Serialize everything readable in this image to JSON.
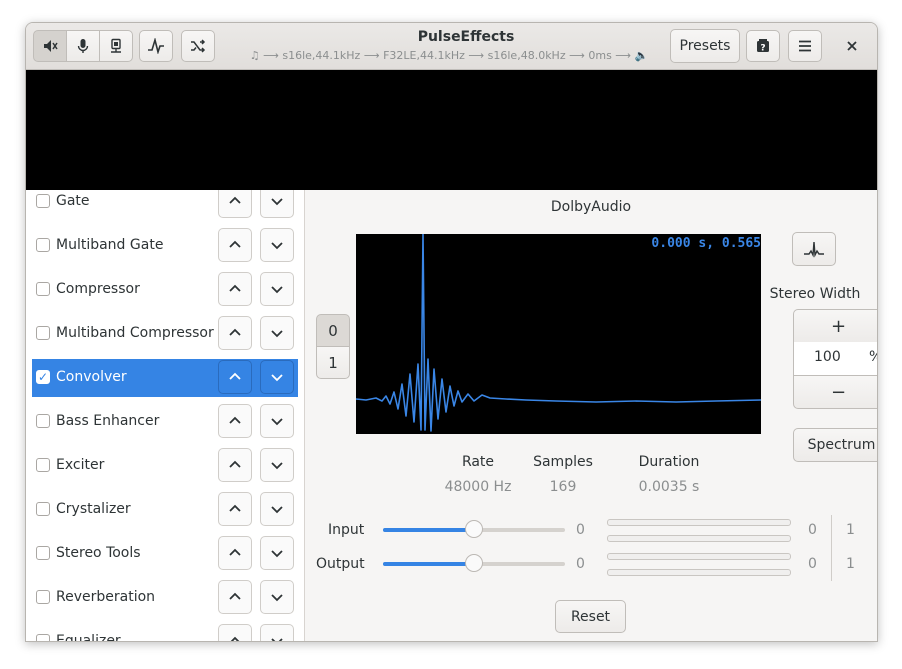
{
  "app": {
    "title": "PulseEffects",
    "pipeline": "⟶ s16le,44.1kHz ⟶ F32LE,44.1kHz ⟶ s16le,48.0kHz ⟶ 0ms ⟶",
    "presets_label": "Presets"
  },
  "plugins": [
    {
      "label": "Gate",
      "checked": false
    },
    {
      "label": "Multiband Gate",
      "checked": false
    },
    {
      "label": "Compressor",
      "checked": false
    },
    {
      "label": "Multiband Compressor",
      "checked": false
    },
    {
      "label": "Convolver",
      "checked": true,
      "selected": true
    },
    {
      "label": "Bass Enhancer",
      "checked": false
    },
    {
      "label": "Exciter",
      "checked": false
    },
    {
      "label": "Crystalizer",
      "checked": false
    },
    {
      "label": "Stereo Tools",
      "checked": false
    },
    {
      "label": "Reverberation",
      "checked": false
    },
    {
      "label": "Equalizer",
      "checked": false
    }
  ],
  "convolver": {
    "title": "DolbyAudio",
    "readout": "0.000 s, 0.565",
    "channel_buttons": [
      "0",
      "1"
    ],
    "stats": [
      {
        "label": "Rate",
        "value": "48000 Hz"
      },
      {
        "label": "Samples",
        "value": "169"
      },
      {
        "label": "Duration",
        "value": "0.0035 s"
      }
    ],
    "stereo_width_label": "Stereo Width",
    "stereo_width_value": "100",
    "stereo_width_unit": "%",
    "plus": "+",
    "minus": "−",
    "spectrum_label": "Spectrum",
    "input": {
      "label": "Input",
      "value": "0",
      "level_fraction": 0.5
    },
    "output": {
      "label": "Output",
      "value": "0",
      "level_fraction": 0.5
    },
    "meter_labels": [
      "0",
      "1"
    ],
    "reset_label": "Reset"
  },
  "colors": {
    "accent": "#3584e4",
    "plot_line": "#3a86e6"
  }
}
